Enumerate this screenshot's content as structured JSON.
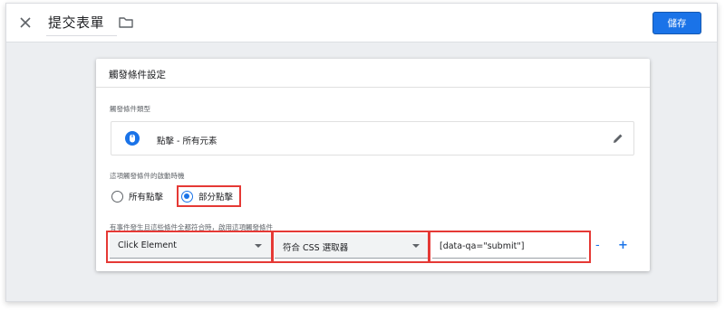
{
  "header": {
    "title": "提交表單",
    "save_label": "儲存"
  },
  "card": {
    "title": "觸發條件設定",
    "type_label": "觸發條件類型",
    "type_value": "點擊 - 所有元素",
    "fire_label": "這項觸發條件的啟動時機",
    "radio_all": "所有點擊",
    "radio_some": "部分點擊",
    "selected_radio": "部分點擊",
    "condition_label": "有事件發生且這些條件全都符合時，啟用這項觸發條件",
    "condition": {
      "variable": "Click Element",
      "operator": "符合 CSS 選取器",
      "value": "[data-qa=\"submit\"]",
      "remove_label": "-",
      "add_label": "+"
    }
  },
  "colors": {
    "accent": "#1a73e8",
    "highlight": "#e53935"
  },
  "icons": [
    "close-icon",
    "folder-icon",
    "click-icon",
    "edit-icon"
  ]
}
